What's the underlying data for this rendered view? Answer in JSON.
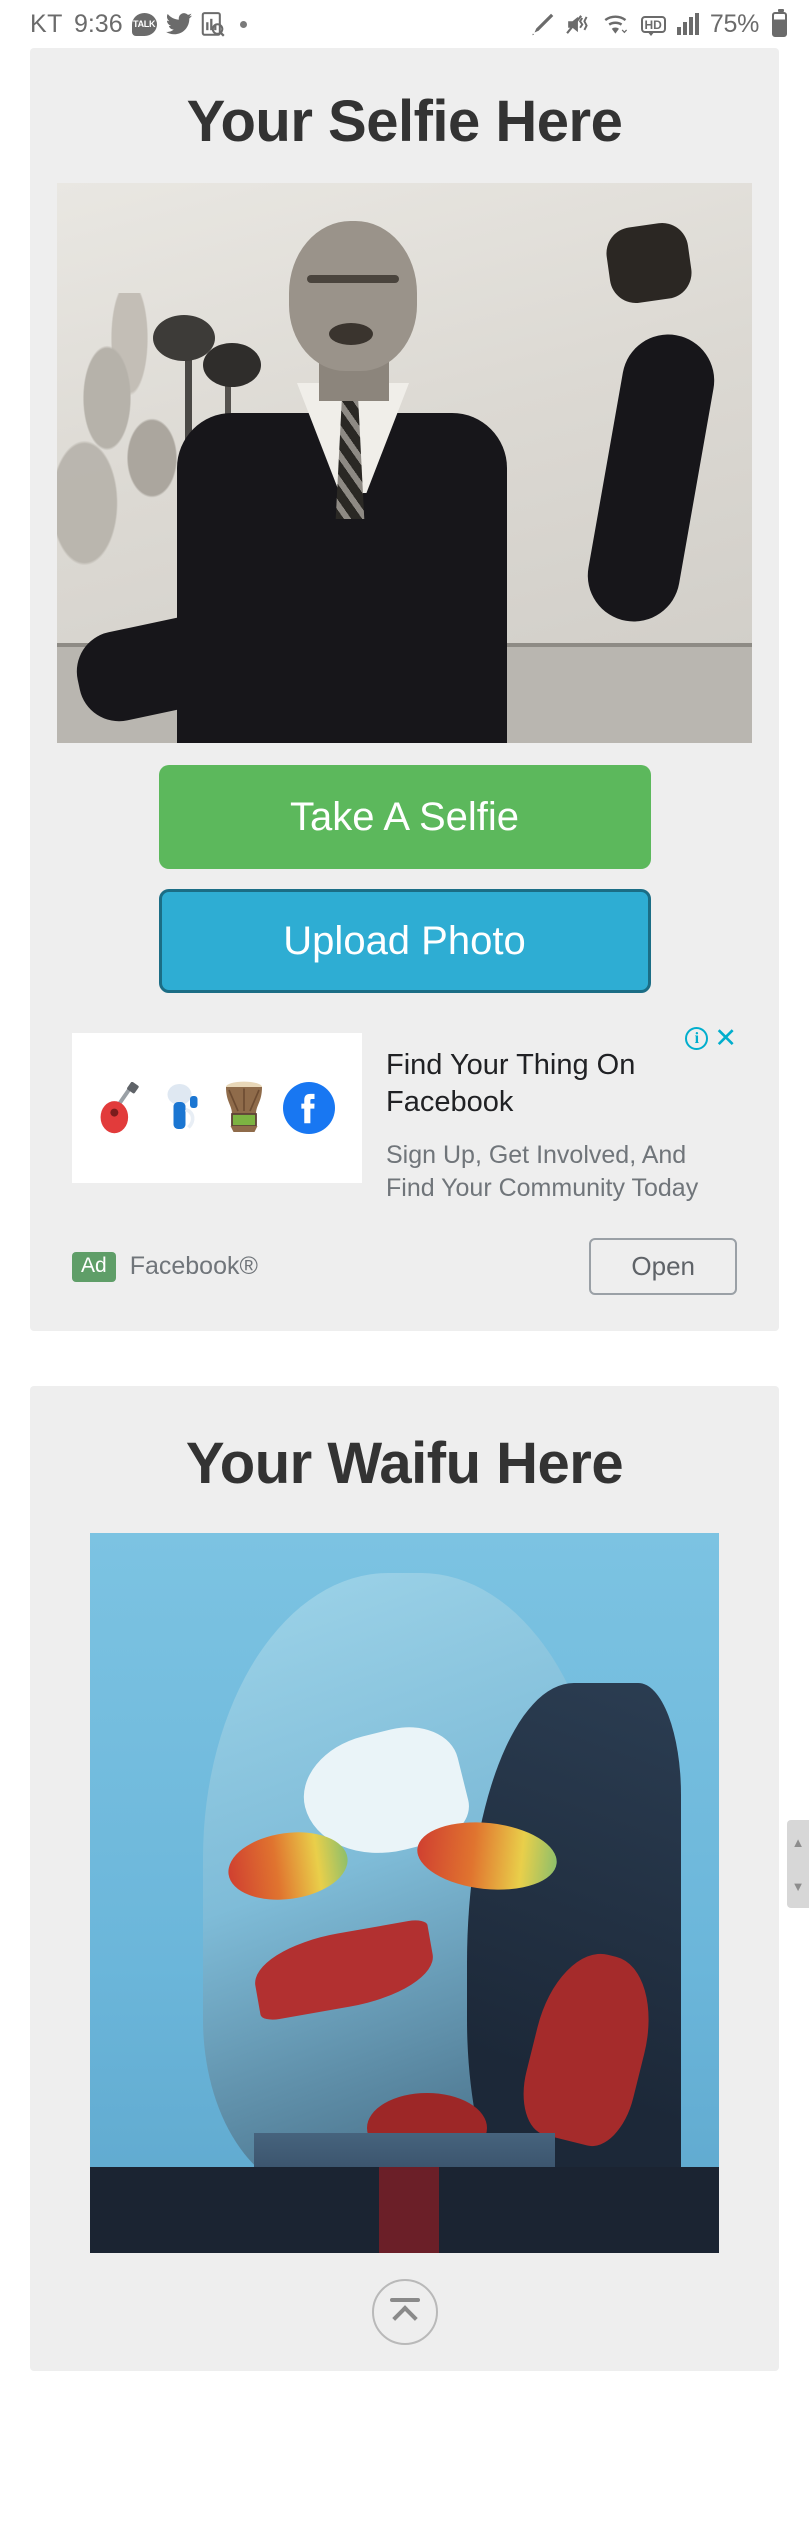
{
  "statusbar": {
    "carrier": "KT",
    "time": "9:36",
    "talk_icon_label": "TALK",
    "battery_percent": "75%",
    "icons": [
      "kakaotalk-icon",
      "twitter-icon",
      "document-search-icon",
      "dot-icon",
      "stylus-icon",
      "mute-vibrate-icon",
      "wifi-icon",
      "hd-icon",
      "signal-bars-icon",
      "battery-icon"
    ]
  },
  "selfie_section": {
    "title": "Your Selfie Here",
    "photo_alt": "black and white photo of man speaking at microphones with raised fist",
    "take_selfie_label": "Take A Selfie",
    "upload_photo_label": "Upload Photo",
    "green_color": "#5cb85c",
    "blue_color": "#2eadd3",
    "blue_border_color": "#1b6d85"
  },
  "ad": {
    "title": "Find Your Thing On Facebook",
    "description": "Sign Up, Get Involved, And Find Your Community Today",
    "badge": "Ad",
    "advertiser": "Facebook®",
    "open_label": "Open",
    "adchoices_info": "i",
    "close_label": "✕",
    "accent_color": "#00aecd",
    "badge_color": "#5f9e68",
    "thumb_icons": [
      "guitar-icon",
      "microphone-icon",
      "djembe-drum-icon",
      "facebook-logo-icon"
    ]
  },
  "waifu_section": {
    "title": "Your Waifu Here",
    "photo_alt": "stylized blue posterized portrait artwork"
  },
  "scroll_top": {
    "label": "scroll to top"
  }
}
